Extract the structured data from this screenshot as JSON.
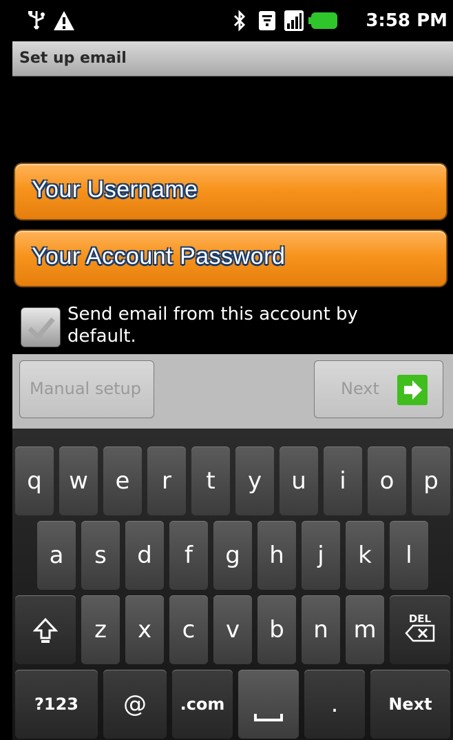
{
  "status_bar": {
    "time": "3:58 PM",
    "icons": [
      "usb-icon",
      "warning-icon",
      "bluetooth-icon",
      "wifi-icon",
      "signal-icon",
      "battery-icon"
    ]
  },
  "title_bar": {
    "title": "Set up email"
  },
  "form": {
    "username_field": {
      "value": "Your Username"
    },
    "password_field": {
      "value": "Your Account Password"
    },
    "default_checkbox": {
      "label": "Send email from this account by default.",
      "checked": true
    }
  },
  "buttons": {
    "manual_setup": "Manual setup",
    "next": "Next"
  },
  "keyboard": {
    "row1": [
      "q",
      "w",
      "e",
      "r",
      "t",
      "y",
      "u",
      "i",
      "o",
      "p"
    ],
    "row2": [
      "a",
      "s",
      "d",
      "f",
      "g",
      "h",
      "j",
      "k",
      "l"
    ],
    "row3": [
      "z",
      "x",
      "c",
      "v",
      "b",
      "n",
      "m"
    ],
    "del_label": "DEL",
    "row4": {
      "symbols": "?123",
      "at": "@",
      "dotcom": ".com",
      "period": ".",
      "next": "Next"
    }
  },
  "colors": {
    "field_orange": "#f7941d",
    "field_text_outline": "#1b3c6b",
    "next_arrow_green": "#3fbe1e"
  }
}
